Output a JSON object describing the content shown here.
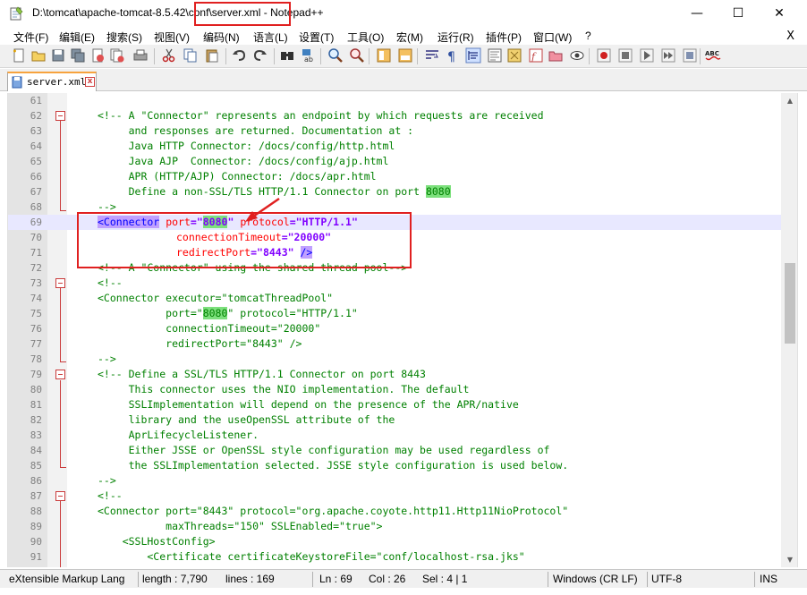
{
  "window": {
    "title_prefix": "D:\\tomcat\\apache-tomcat-8.5.42",
    "title_highlight": "\\conf\\server.xml",
    "title_suffix": " - Notepad++",
    "minimize": "—",
    "maximize": "☐",
    "close": "✕"
  },
  "menu": {
    "items": [
      "文件(F)",
      "编辑(E)",
      "搜索(S)",
      "视图(V)",
      "编码(N)",
      "语言(L)",
      "设置(T)",
      "工具(O)",
      "宏(M)",
      "运行(R)",
      "插件(P)",
      "窗口(W)",
      "?"
    ],
    "close": "X"
  },
  "toolbar": {
    "icons": [
      "new-file-icon",
      "open-file-icon",
      "save-icon",
      "save-all-icon",
      "close-icon",
      "close-all-icon",
      "print-icon",
      "cut-icon",
      "copy-icon",
      "paste-icon",
      "undo-icon",
      "redo-icon",
      "find-icon",
      "replace-icon",
      "zoom-in-icon",
      "zoom-out-icon",
      "sync-v-icon",
      "sync-h-icon",
      "wrap-icon",
      "all-chars-icon",
      "indent-guide-icon",
      "udl-icon",
      "doc-map-icon",
      "function-list-icon",
      "folder-workspace-icon",
      "monitor-icon",
      "record-macro-icon",
      "stop-macro-icon",
      "play-macro-icon",
      "run-macro-multiple-icon",
      "save-macro-icon",
      "spellcheck-icon"
    ],
    "spell_label": "ABC"
  },
  "tab": {
    "label": "server.xml",
    "close": "x"
  },
  "editor": {
    "lines": [
      {
        "n": "61"
      },
      {
        "n": "62"
      },
      {
        "n": "63"
      },
      {
        "n": "64"
      },
      {
        "n": "65"
      },
      {
        "n": "66"
      },
      {
        "n": "67"
      },
      {
        "n": "68"
      },
      {
        "n": "69"
      },
      {
        "n": "70"
      },
      {
        "n": "71"
      },
      {
        "n": "72"
      },
      {
        "n": "73"
      },
      {
        "n": "74"
      },
      {
        "n": "75"
      },
      {
        "n": "76"
      },
      {
        "n": "77"
      },
      {
        "n": "78"
      },
      {
        "n": "79"
      },
      {
        "n": "80"
      },
      {
        "n": "81"
      },
      {
        "n": "82"
      },
      {
        "n": "83"
      },
      {
        "n": "84"
      },
      {
        "n": "85"
      },
      {
        "n": "86"
      },
      {
        "n": "87"
      },
      {
        "n": "88"
      },
      {
        "n": "89"
      },
      {
        "n": "90"
      },
      {
        "n": "91"
      }
    ],
    "text": {
      "l62": "<!-- A \"Connector\" represents an endpoint by which requests are received",
      "l63": "     and responses are returned. Documentation at :",
      "l64": "     Java HTTP Connector: /docs/config/http.html",
      "l65": "     Java AJP  Connector: /docs/config/ajp.html",
      "l66": "     APR (HTTP/AJP) Connector: /docs/apr.html",
      "l67a": "     Define a non-SSL/TLS HTTP/1.1 Connector on port ",
      "l67b": "8080",
      "l68": "-->",
      "l69_tag": "<Connector",
      "l69_attr1": "port",
      "l69_eq1": "=\"",
      "l69_val1": "8080",
      "l69_q1": "\"",
      "l69_attr2": "protocol",
      "l69_val2": "=\"HTTP/1.1\"",
      "l70_attr": "connectionTimeout",
      "l70_val": "=\"20000\"",
      "l71_attr": "redirectPort",
      "l71_val": "=\"8443\"",
      "l71_end": "/>",
      "l72": "<!-- A \"Connector\" using the shared thread pool-->",
      "l73": "<!--",
      "l74": "<Connector executor=\"tomcatThreadPool\"",
      "l75a": "           port=\"",
      "l75b": "8080",
      "l75c": "\" protocol=\"HTTP/1.1\"",
      "l76": "           connectionTimeout=\"20000\"",
      "l77": "           redirectPort=\"8443\" />",
      "l78": "-->",
      "l79": "<!-- Define a SSL/TLS HTTP/1.1 Connector on port 8443",
      "l80": "     This connector uses the NIO implementation. The default",
      "l81": "     SSLImplementation will depend on the presence of the APR/native",
      "l82": "     library and the useOpenSSL attribute of the",
      "l83": "     AprLifecycleListener.",
      "l84": "     Either JSSE or OpenSSL style configuration may be used regardless of",
      "l85": "     the SSLImplementation selected. JSSE style configuration is used below.",
      "l86": "-->",
      "l87": "<!--",
      "l88": "<Connector port=\"8443\" protocol=\"org.apache.coyote.http11.Http11NioProtocol\"",
      "l89": "           maxThreads=\"150\" SSLEnabled=\"true\">",
      "l90": "    <SSLHostConfig>",
      "l91": "        <Certificate certificateKeystoreFile=\"conf/localhost-rsa.jks\""
    }
  },
  "status": {
    "lang": "eXtensible Markup Lang",
    "length": "length : 7,790",
    "lines": "lines : 169",
    "ln": "Ln : 69",
    "col": "Col : 26",
    "sel": "Sel : 4 | 1",
    "eol": "Windows (CR LF)",
    "enc": "UTF-8",
    "ins": "INS"
  },
  "colors": {
    "annotation": "#e02020",
    "fold_marker": "#ca3b3b",
    "tab_accent": "#f7a33e",
    "current_line": "#e8e8ff"
  }
}
